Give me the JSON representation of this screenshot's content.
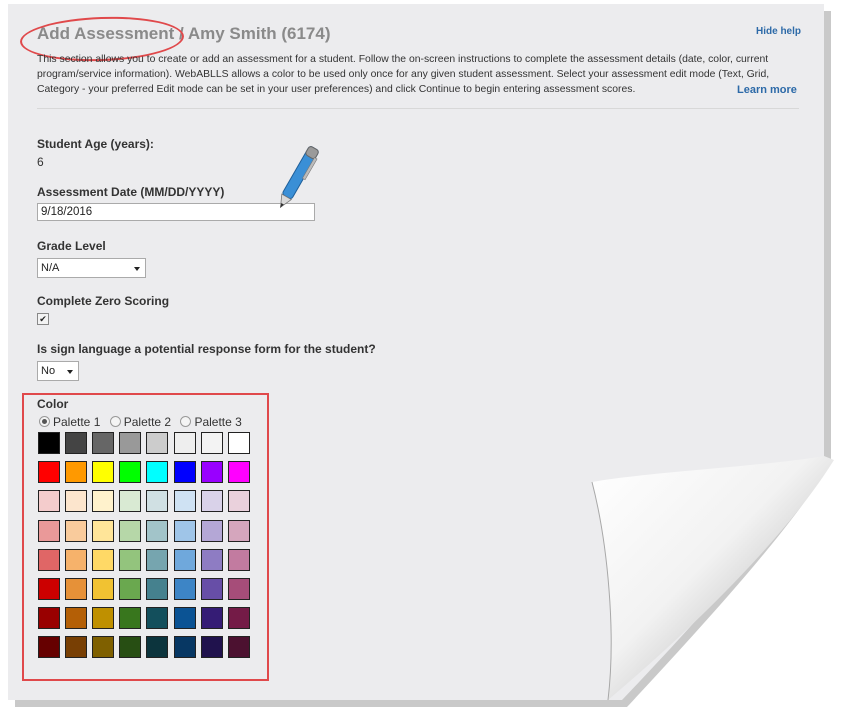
{
  "header": {
    "title": "Add Assessment / Amy Smith (6174)",
    "hide_help": "Hide help",
    "help_text": "This section allows you to create or add an assessment for a student. Follow the on-screen instructions to complete the assessment details (date, color, current program/service information). WebABLLS allows a color to be used only once for any given student assessment. Select your assessment edit mode (Text, Grid, Category - your preferred Edit mode can be set in your user preferences) and click Continue to begin entering assessment scores.",
    "learn_more": "Learn more"
  },
  "form": {
    "age_label": "Student Age (years):",
    "age_value": "6",
    "date_label": "Assessment Date (MM/DD/YYYY)",
    "date_value": "9/18/2016",
    "grade_label": "Grade Level",
    "grade_value": "N/A",
    "zero_label": "Complete Zero Scoring",
    "zero_checked": "✔",
    "sign_label": "Is sign language a potential response form for the student?",
    "sign_value": "No"
  },
  "color": {
    "label": "Color",
    "palettes": [
      "Palette 1",
      "Palette 2",
      "Palette 3"
    ],
    "selected_palette": "Palette 1",
    "swatches": [
      [
        "#000000",
        "#444444",
        "#666666",
        "#999999",
        "#cccccc",
        "#eeeeee",
        "#f3f3f3",
        "#ffffff"
      ],
      [
        "#ff0000",
        "#ff9900",
        "#ffff00",
        "#00ff00",
        "#00ffff",
        "#0000ff",
        "#9900ff",
        "#ff00ff"
      ],
      [
        "#f4cccc",
        "#fce5cd",
        "#fff2cc",
        "#d9ead3",
        "#d0e0e3",
        "#cfe2f3",
        "#d9d2e9",
        "#ead1dc"
      ],
      [
        "#ea9999",
        "#f9cb9c",
        "#ffe599",
        "#b6d7a8",
        "#a2c4c9",
        "#9fc5e8",
        "#b4a7d6",
        "#d5a6bd"
      ],
      [
        "#e06666",
        "#f6b26b",
        "#ffd966",
        "#93c47d",
        "#76a5af",
        "#6fa8dc",
        "#8e7cc3",
        "#c27ba0"
      ],
      [
        "#cc0000",
        "#e69138",
        "#f1c232",
        "#6aa84f",
        "#45818e",
        "#3d85c6",
        "#674ea7",
        "#a64d79"
      ],
      [
        "#990000",
        "#b45f06",
        "#bf9000",
        "#38761d",
        "#134f5c",
        "#0b5394",
        "#351c75",
        "#741b47"
      ],
      [
        "#660000",
        "#783f04",
        "#7f6000",
        "#274e13",
        "#0c343d",
        "#073763",
        "#20124d",
        "#4c1130"
      ]
    ]
  },
  "theme": {
    "page_bg": "#ececee",
    "highlight": "#e0494b",
    "link": "#2d6aa8"
  }
}
